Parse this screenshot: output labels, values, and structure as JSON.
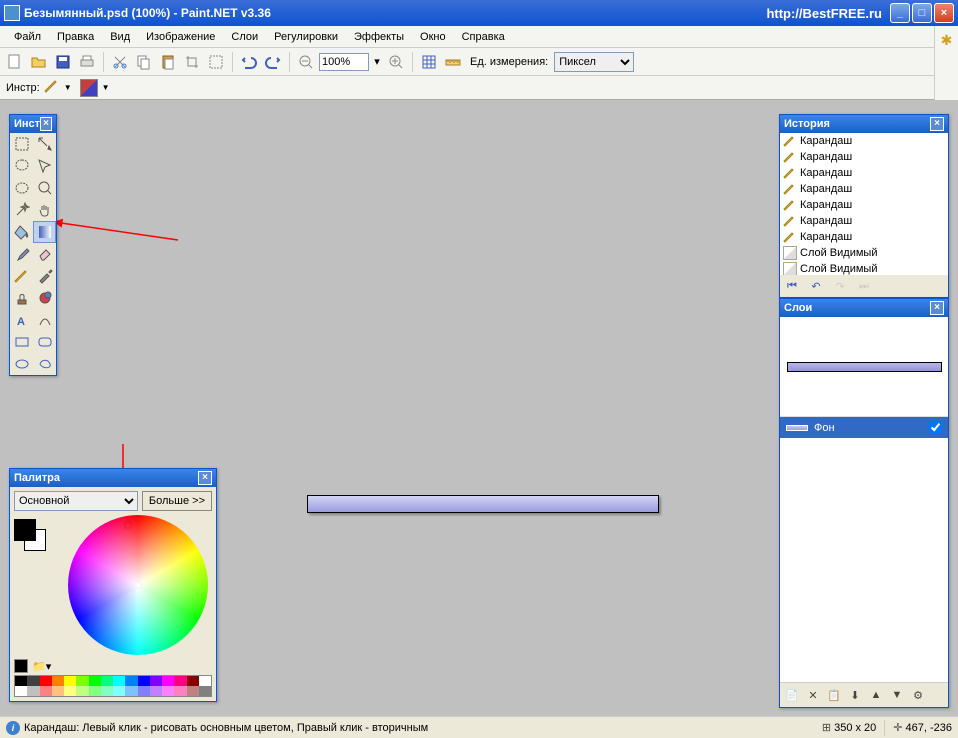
{
  "window": {
    "title": "Безымянный.psd (100%) - Paint.NET v3.36",
    "url": "http://BestFREE.ru"
  },
  "menu": {
    "items": [
      "Файл",
      "Правка",
      "Вид",
      "Изображение",
      "Слои",
      "Регулировки",
      "Эффекты",
      "Окно",
      "Справка"
    ]
  },
  "toolbar": {
    "zoom": "100%",
    "units_label": "Ед. измерения:",
    "units_value": "Пиксел"
  },
  "toolbar2": {
    "label": "Инстр:"
  },
  "tools_panel": {
    "title": "Инст"
  },
  "history_panel": {
    "title": "История",
    "items": [
      {
        "icon": "pencil",
        "label": "Карандаш"
      },
      {
        "icon": "pencil",
        "label": "Карандаш"
      },
      {
        "icon": "pencil",
        "label": "Карандаш"
      },
      {
        "icon": "pencil",
        "label": "Карандаш"
      },
      {
        "icon": "pencil",
        "label": "Карандаш"
      },
      {
        "icon": "pencil",
        "label": "Карандаш"
      },
      {
        "icon": "pencil",
        "label": "Карандаш"
      },
      {
        "icon": "layer",
        "label": "Слой Видимый"
      },
      {
        "icon": "layer",
        "label": "Слой Видимый"
      }
    ]
  },
  "layers_panel": {
    "title": "Слои",
    "layer_name": "Фон"
  },
  "palette_panel": {
    "title": "Палитра",
    "mode": "Основной",
    "more_btn": "Больше >>"
  },
  "statusbar": {
    "hint": "Карандаш: Левый клик - рисовать основным цветом, Правый клик - вторичным",
    "size": "350 x 20",
    "coords": "467, -236"
  },
  "colors": {
    "accent": "#316ac5",
    "titlebar": "#0d53d0"
  }
}
